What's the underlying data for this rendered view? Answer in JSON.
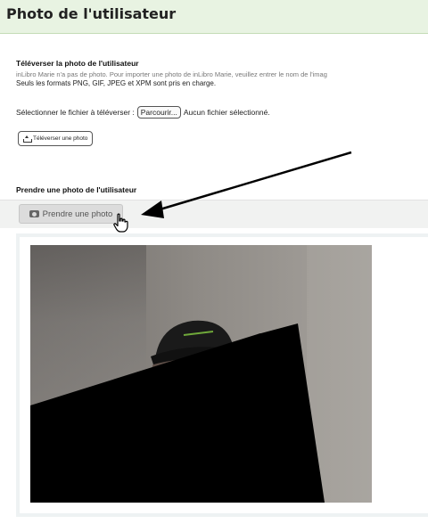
{
  "page": {
    "title": "Photo de l'utilisateur"
  },
  "upload": {
    "heading": "Téléverser la photo de l'utilisateur",
    "hint": "inLibro Marie n'a pas de photo. Pour importer une photo de inLibro Marie, veuillez entrer le nom de l'imag",
    "formats": "Seuls les formats PNG, GIF, JPEG et XPM sont pris en charge.",
    "select_label": "Sélectionner le fichier à téléverser :",
    "browse_label": "Parcourir...",
    "no_file_label": "Aucun fichier sélectionné.",
    "upload_button_label": "Téléverser une photo",
    "upload_icon": "upload-icon"
  },
  "take": {
    "heading": "Prendre une photo de l'utilisateur",
    "button_label": "Prendre une photo",
    "button_icon": "camera-icon"
  },
  "colors": {
    "header_bg": "#e8f3e2",
    "toolbar_bg": "#f1f2f1",
    "button_bg": "#dcdcdc"
  }
}
